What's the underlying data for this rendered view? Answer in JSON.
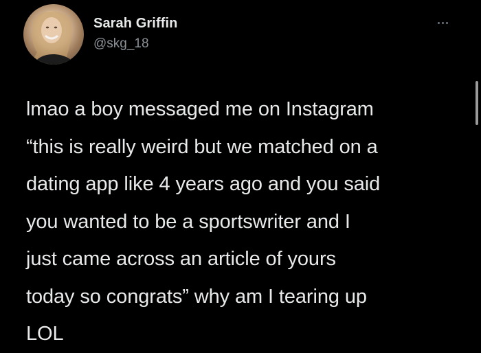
{
  "tweet": {
    "author": {
      "display_name": "Sarah Griffin",
      "handle": "@skg_18",
      "avatar_icon": "profile-photo"
    },
    "more_icon": "more-horizontal-icon",
    "text": "lmao a boy messaged me on Instagram\n“this is really weird but we matched on a\ndating app like 4 years ago and you said\nyou wanted to be a sportswriter and I\njust came across an article of yours\ntoday so congrats” why am I tearing up\nLOL"
  },
  "colors": {
    "background": "#000000",
    "primary_text": "#e7e9ea",
    "secondary_text": "#8b9197"
  }
}
